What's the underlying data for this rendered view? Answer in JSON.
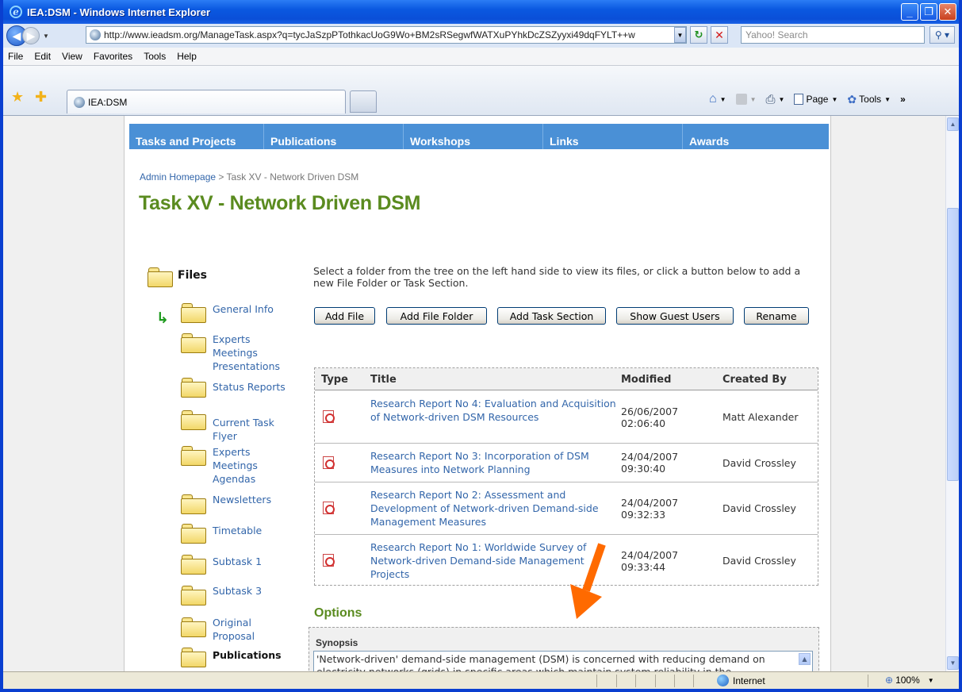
{
  "window": {
    "title": "IEA:DSM - Windows Internet Explorer"
  },
  "address_bar": {
    "url": "http://www.ieadsm.org/ManageTask.aspx?q=tycJaSzpPTothkacUoG9Wo+BM2sRSegwfWATXuPYhkDcZSZyyxi49dqFYLT++w",
    "search_placeholder": "Yahoo! Search"
  },
  "menu": [
    "File",
    "Edit",
    "View",
    "Favorites",
    "Tools",
    "Help"
  ],
  "tab": {
    "label": "IEA:DSM"
  },
  "command_bar": {
    "page_label": "Page",
    "tools_label": "Tools"
  },
  "site_nav": [
    {
      "label": "Tasks and Projects"
    },
    {
      "label": "Publications"
    },
    {
      "label": "Workshops"
    },
    {
      "label": "Links"
    },
    {
      "label": "Awards"
    }
  ],
  "breadcrumb": {
    "home": "Admin Homepage",
    "separator": ">",
    "current": "Task XV - Network Driven DSM"
  },
  "page_title": "Task XV - Network Driven DSM",
  "tree": {
    "root_label": "Files",
    "folders": [
      "General Info",
      "Experts Meetings Presentations",
      "Status Reports",
      "Current Task Flyer",
      "Experts Meetings Agendas",
      "Newsletters",
      "Timetable",
      "Subtask 1",
      "Subtask 3",
      "Original Proposal",
      "Publications"
    ]
  },
  "instructions": "Select a folder from the tree on the left hand side to view its files, or click a button below to add a new File Folder or Task Section.",
  "buttons": {
    "add_file": "Add File",
    "add_file_folder": "Add File Folder",
    "add_task_section": "Add Task Section",
    "show_guest_users": "Show Guest Users",
    "rename": "Rename"
  },
  "table": {
    "headers": {
      "type": "Type",
      "title": "Title",
      "modified": "Modified",
      "created_by": "Created By"
    },
    "rows": [
      {
        "title": "Research Report No 4: Evaluation and Acquisition of Network-driven DSM Resources",
        "modified_date": "26/06/2007",
        "modified_time": "02:06:40",
        "created_by": "Matt Alexander"
      },
      {
        "title": "Research Report No 3: Incorporation of DSM Measures into Network Planning",
        "modified_date": "24/04/2007",
        "modified_time": "09:30:40",
        "created_by": "David Crossley"
      },
      {
        "title": "Research Report No 2: Assessment and Development of Network-driven Demand-side Management Measures",
        "modified_date": "24/04/2007",
        "modified_time": "09:32:33",
        "created_by": "David Crossley"
      },
      {
        "title": "Research Report No 1: Worldwide Survey of Network-driven Demand-side Management Projects",
        "modified_date": "24/04/2007",
        "modified_time": "09:33:44",
        "created_by": "David Crossley"
      }
    ]
  },
  "options": {
    "title": "Options",
    "synopsis_label": "Synopsis",
    "synopsis_text": "'Network-driven' demand-side management (DSM) is concerned with reducing demand on electricity networks (grids) in specific areas which maintain system reliability in the"
  },
  "status_bar": {
    "zone": "Internet",
    "zoom": "100%"
  },
  "colors": {
    "nav_blue": "#4a90d6",
    "title_green": "#5a8b1f",
    "link_blue": "#3366aa",
    "annotation_orange": "#ff6a00"
  }
}
